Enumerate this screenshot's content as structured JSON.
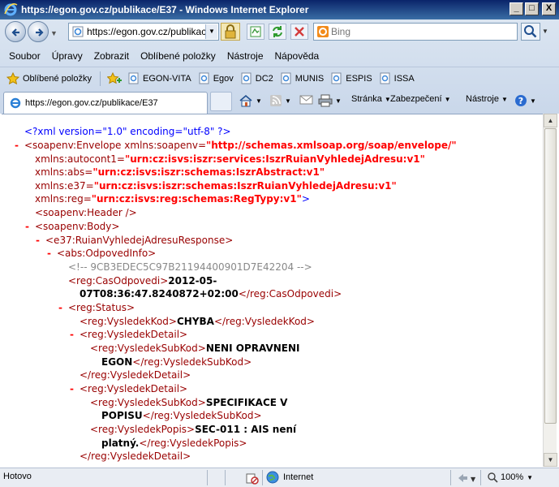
{
  "window": {
    "title": "https://egon.gov.cz/publikace/E37 - Windows Internet Explorer",
    "minimize_glyph": "_",
    "maximize_glyph": "□",
    "close_glyph": "X"
  },
  "address_bar": {
    "url": "https://egon.gov.cz/publikace/E37",
    "icon": "page-icon",
    "security": "lock-icon"
  },
  "search": {
    "placeholder": "Bing",
    "provider_icon": "bing-icon",
    "button_icon": "magnifier-icon"
  },
  "menu": {
    "items": [
      "Soubor",
      "Úpravy",
      "Zobrazit",
      "Oblíbené položky",
      "Nástroje",
      "Nápověda"
    ]
  },
  "favorites_bar": {
    "label": "Oblíbené položky",
    "items": [
      "EGON-VITA",
      "Egov",
      "DC2",
      "MUNIS",
      "ESPIS",
      "ISSA"
    ]
  },
  "tab": {
    "title": "https://egon.gov.cz/publikace/E37"
  },
  "command_bar": {
    "page": "Stránka",
    "security": "Zabezpečení",
    "tools": "Nástroje",
    "help_icon": "help-icon"
  },
  "xml": {
    "l1": "<?xml version=\"1.0\" encoding=\"utf-8\" ?>",
    "l2_open": "<soapenv:Envelope",
    "l2_attr": "xmlns:soapenv=",
    "l2_val": "\"http://schemas.xmlsoap.org/soap/envelope/\"",
    "l3_attr": "xmlns:autocont1=",
    "l3_val": "\"urn:cz:isvs:iszr:services:IszrRuianVyhledejAdresu:v1\"",
    "l4_attr": "xmlns:abs=",
    "l4_val": "\"urn:cz:isvs:iszr:schemas:IszrAbstract:v1\"",
    "l5_attr": "xmlns:e37=",
    "l5_val": "\"urn:cz:isvs:iszr:schemas:IszrRuianVyhledejAdresu:v1\"",
    "l6_attr": "xmlns:reg=",
    "l6_val": "\"urn:cz:isvs:reg:schemas:RegTypy:v1\"",
    "l6_close": ">",
    "l7": "<soapenv:Header />",
    "l8": "<soapenv:Body>",
    "l9": "<e37:RuianVyhledejAdresuResponse>",
    "l10": "<abs:OdpovedInfo>",
    "l11": "<!-- 9CB3EDEC5C97B21194400901D7E42204 -->",
    "l12_open": "<reg:CasOdpovedi>",
    "l12_text": "2012-05-",
    "l13_text": "07T08:36:47.8240872+02:00",
    "l13_close": "</reg:CasOdpovedi>",
    "l14": "<reg:Status>",
    "l15_open": "<reg:VysledekKod>",
    "l15_text": "CHYBA",
    "l15_close": "</reg:VysledekKod>",
    "l16": "<reg:VysledekDetail>",
    "l17_open": "<reg:VysledekSubKod>",
    "l17_text": "NENI OPRAVNENI",
    "l18_text": "EGON",
    "l18_close": "</reg:VysledekSubKod>",
    "l19": "</reg:VysledekDetail>",
    "l20": "<reg:VysledekDetail>",
    "l21_open": "<reg:VysledekSubKod>",
    "l21_text": "SPECIFIKACE V",
    "l22_text": "POPISU",
    "l22_close": "</reg:VysledekSubKod>",
    "l23_open": "<reg:VysledekPopis>",
    "l23_text": "SEC-011 : AIS není",
    "l24_text": "platný.",
    "l24_close": "</reg:VysledekPopis>",
    "l25": "</reg:VysledekDetail>",
    "minus": "-"
  },
  "status_bar": {
    "text": "Hotovo",
    "zone": "Internet",
    "zoom": "100%"
  }
}
